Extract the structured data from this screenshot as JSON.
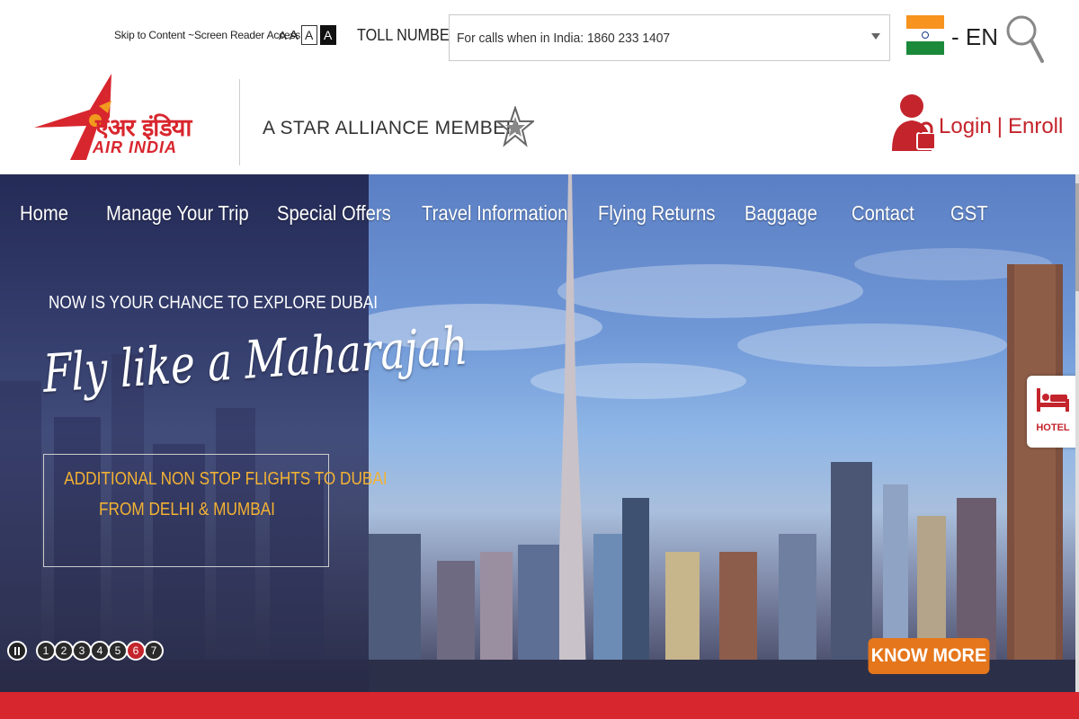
{
  "accessibility": {
    "skip_label": "Skip to Content ~Screen Reader Access",
    "font_small": "A",
    "font_medium": "A",
    "font_normal": "A",
    "font_dark": "A"
  },
  "toll": {
    "label": "TOLL NUMBER",
    "selected": "For calls when in India: 1860 233 1407"
  },
  "language": {
    "label": "- EN",
    "flag": "india-flag-icon"
  },
  "header": {
    "logo_hindi": "एअर इंडिया",
    "logo_english": "AIR INDIA",
    "alliance": "A STAR ALLIANCE MEMBER",
    "login": "Login",
    "separator": "|",
    "enroll": "Enroll"
  },
  "nav": {
    "items": [
      {
        "label": "Home"
      },
      {
        "label": "Manage Your Trip"
      },
      {
        "label": "Special Offers"
      },
      {
        "label": "Travel Information"
      },
      {
        "label": "Flying Returns"
      },
      {
        "label": "Baggage"
      },
      {
        "label": "Contact"
      },
      {
        "label": "GST"
      }
    ]
  },
  "promo": {
    "headline": "NOW IS YOUR CHANCE TO EXPLORE DUBAI",
    "script": "Fly like a Maharajah",
    "line1": "ADDITIONAL NON STOP FLIGHTS TO DUBAI",
    "line2": "FROM DELHI & MUMBAI",
    "cta": "KNOW MORE"
  },
  "hotel": {
    "label": "HOTEL"
  },
  "slider": {
    "slides": [
      "1",
      "2",
      "3",
      "4",
      "5",
      "6",
      "7"
    ],
    "active_slide": 6
  },
  "colors": {
    "brand_red": "#d8262e",
    "promo_gold": "#f3b233",
    "cta_orange": "#e5761b"
  }
}
